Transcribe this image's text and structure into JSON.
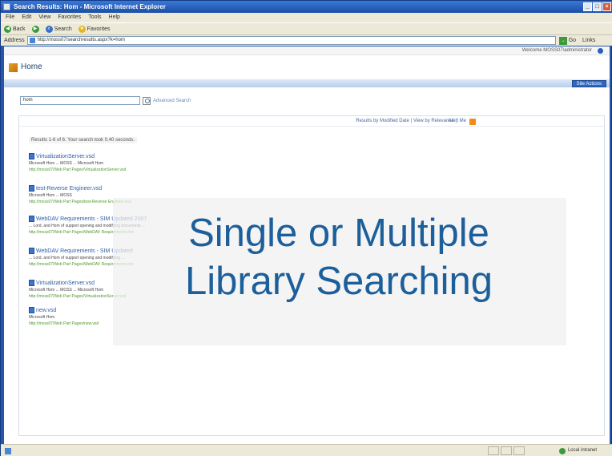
{
  "window": {
    "title": "Search Results: Hom - Microsoft Internet Explorer"
  },
  "menu": [
    "File",
    "Edit",
    "View",
    "Favorites",
    "Tools",
    "Help"
  ],
  "toolbar": {
    "back_label": "Back",
    "search_label": "Search",
    "favorites_label": "Favorites"
  },
  "address": {
    "label": "Address",
    "value": "http://moss07/searchresults.aspx?k=hom",
    "go_label": "Go",
    "links_label": "Links"
  },
  "sharepoint": {
    "welcome": "Welcome MOSS07\\administrator",
    "site_title": "Home",
    "site_actions": "Site Actions"
  },
  "search": {
    "query": "hom",
    "advanced_label": "Advanced Search"
  },
  "results_toolbar": {
    "sort_text": "Results by Modified Date | View by Relevance |",
    "alert_text": "Alert Me",
    "rss_text": "RSS"
  },
  "results": {
    "count_text": "Results 1-6 of 6. Your search took 0.40 seconds.",
    "items": [
      {
        "title": "VirtualizationServer.vsd",
        "meta": "Microsoft Hom ... MOSS ... Microsoft Hom",
        "url": "http://moss07/Web Part Pages/VirtualizationServer.vsd"
      },
      {
        "title": "test-Reverse Engineer.vsd",
        "meta": "Microsoft Hom ... MOSS",
        "url": "http://moss07/Web Part Pages/test-Reverse Engineer.vsd"
      },
      {
        "title": "WebDAV Requirements - SIM Updated 2007",
        "meta": "... Lord, and Hom of support opening and modifying documents ...",
        "url": "http://moss07/Web Part Pages/WebDAV Requirements.doc"
      },
      {
        "title": "WebDAV Requirements - SIM Updated",
        "meta": "... Lord, and Hom of support opening and modifying ...",
        "url": "http://moss07/Web Part Pages/WebDAV Requirements.doc"
      },
      {
        "title": "VirtualizationServer.vsd",
        "meta": "Microsoft Hom ... MOSS ... Microsoft Hom",
        "url": "http://moss07/Web Part Pages/VirtualizationServer.vsd"
      },
      {
        "title": "new.vsd",
        "meta": "Microsoft Hom",
        "url": "http://moss07/Web Part Pages/new.vsd"
      }
    ]
  },
  "overlay": {
    "line1": "Single or Multiple",
    "line2": "Library Searching"
  },
  "status": {
    "zone_label": "Local intranet"
  },
  "colors": {
    "overlay_text": "#1c5f9a",
    "url_green": "#4c9a2a",
    "title_blue": "#2e5ea8"
  }
}
